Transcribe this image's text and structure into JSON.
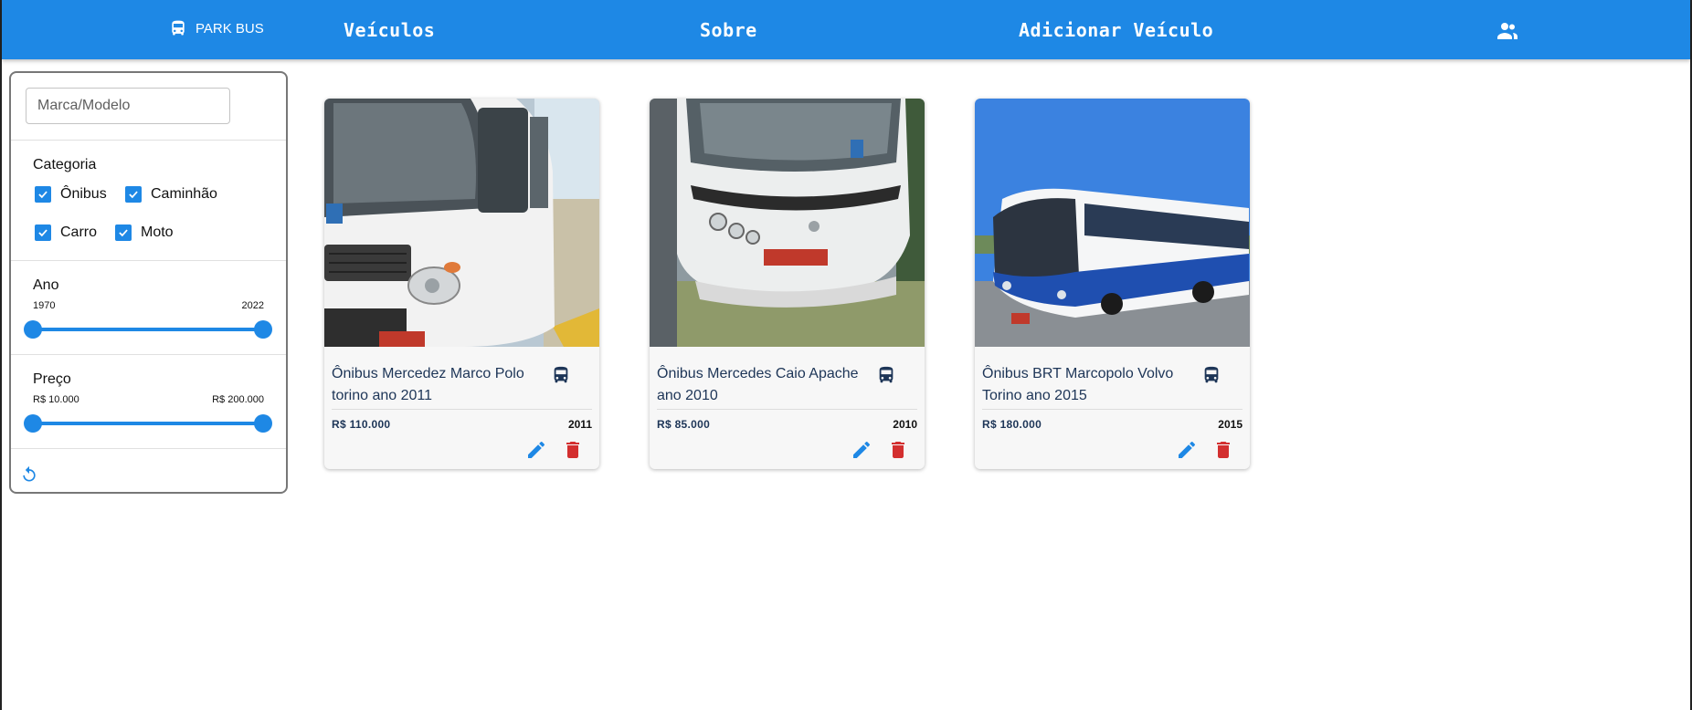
{
  "header": {
    "brand": "PARK BUS",
    "nav": {
      "vehicles": "Veículos",
      "about": "Sobre",
      "add_vehicle": "Adicionar Veículo"
    }
  },
  "filters": {
    "search_placeholder": "Marca/Modelo",
    "category_label": "Categoria",
    "categories": [
      {
        "label": "Ônibus",
        "checked": true
      },
      {
        "label": "Caminhão",
        "checked": true
      },
      {
        "label": "Carro",
        "checked": true
      },
      {
        "label": "Moto",
        "checked": true
      }
    ],
    "year": {
      "label": "Ano",
      "min": "1970",
      "max": "2022"
    },
    "price": {
      "label": "Preço",
      "min": "R$ 10.000",
      "max": "R$ 200.000"
    }
  },
  "vehicles": [
    {
      "title": "Ônibus Mercedez Marco Polo torino ano 2011",
      "price": "R$ 110.000",
      "year": "2011",
      "category_icon": "bus-icon"
    },
    {
      "title": "Ônibus Mercedes Caio Apache ano 2010",
      "price": "R$ 85.000",
      "year": "2010",
      "category_icon": "bus-icon"
    },
    {
      "title": "Ônibus BRT Marcopolo Volvo Torino ano 2015",
      "price": "R$ 180.000",
      "year": "2015",
      "category_icon": "bus-icon"
    }
  ],
  "colors": {
    "primary": "#1e88e5",
    "delete": "#d32f2f",
    "title_text": "#1d3557"
  }
}
